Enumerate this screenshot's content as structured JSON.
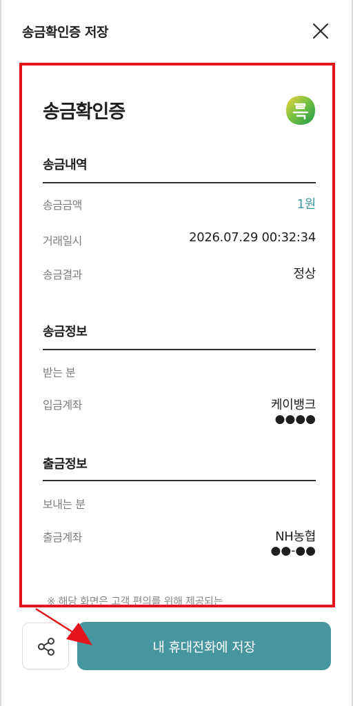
{
  "header": {
    "title": "송금확인증 저장"
  },
  "receipt": {
    "title": "송금확인증",
    "logo_icon": "kakao-pay-style-logo-icon",
    "sections": {
      "transfer_details": {
        "title": "송금내역",
        "amount_label": "송금금액",
        "amount_value": "1원",
        "datetime_label": "거래일시",
        "datetime_value": "2026.07.29 00:32:34",
        "result_label": "송금결과",
        "result_value": "정상"
      },
      "transfer_info": {
        "title": "송금정보",
        "recipient_label": "받는 분",
        "deposit_account_label": "입금계좌",
        "deposit_bank": "케이뱅크",
        "deposit_account_masked": "●●●●"
      },
      "withdraw_info": {
        "title": "출금정보",
        "sender_label": "보내는 분",
        "withdraw_account_label": "출금계좌",
        "withdraw_bank": "NH농협",
        "withdraw_account_masked": "●●-●●"
      }
    },
    "notice": "※ 해당 화면은 고객 편의를 위해 제공되는"
  },
  "footer": {
    "share_icon": "share-icon",
    "save_label": "내 휴대전화에 저장"
  },
  "colors": {
    "accent": "#3a9aa3",
    "button": "#46959f",
    "highlight_border": "#e3141b",
    "annotation_arrow": "#e3141b"
  }
}
